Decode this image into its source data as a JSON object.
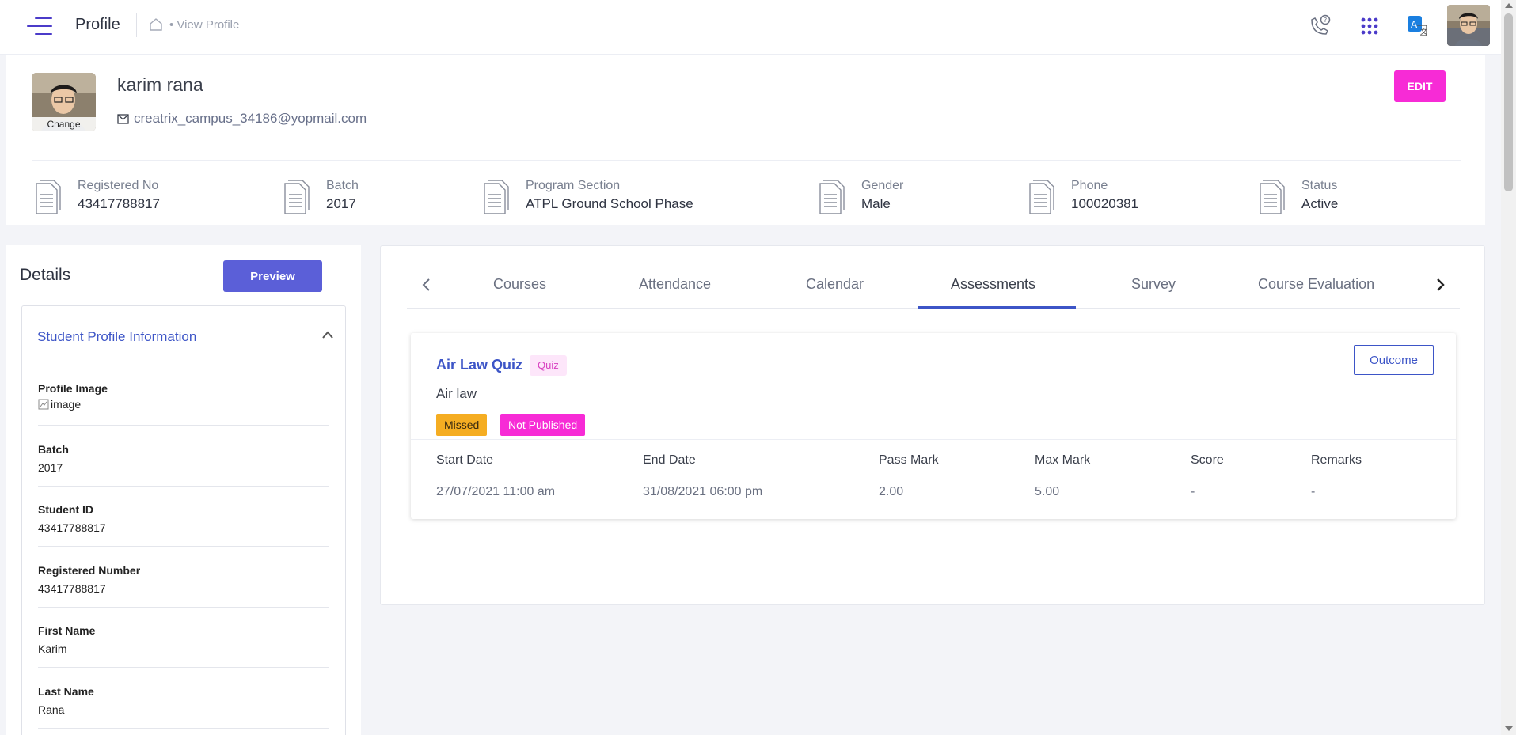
{
  "header": {
    "title": "Profile",
    "breadcrumb": "View Profile"
  },
  "icons": {
    "menu": "hamburger-menu-icon",
    "home": "home-icon",
    "support": "phone-help-icon",
    "apps": "apps-grid-icon",
    "translate": "translate-icon"
  },
  "colors": {
    "brand": "#4b3bc9",
    "accent_blue": "#3d55c7",
    "accent_pink": "#f72bd6",
    "missed": "#f5ad22"
  },
  "profile": {
    "change_label": "Change",
    "name": "karim rana",
    "email": "creatrix_campus_34186@yopmail.com",
    "edit_label": "EDIT",
    "info": [
      {
        "label": "Registered No",
        "value": "43417788817"
      },
      {
        "label": "Batch",
        "value": "2017"
      },
      {
        "label": "Program Section",
        "value": "ATPL Ground School Phase"
      },
      {
        "label": "Gender",
        "value": "Male"
      },
      {
        "label": "Phone",
        "value": "100020381"
      },
      {
        "label": "Status",
        "value": "Active"
      }
    ]
  },
  "details": {
    "title": "Details",
    "preview_label": "Preview",
    "section_title": "Student Profile Information",
    "fields": [
      {
        "label": "Profile Image",
        "value": "image"
      },
      {
        "label": "Batch",
        "value": "2017"
      },
      {
        "label": "Student ID",
        "value": "43417788817"
      },
      {
        "label": "Registered Number",
        "value": "43417788817"
      },
      {
        "label": "First Name",
        "value": "Karim"
      },
      {
        "label": "Last Name",
        "value": "Rana"
      }
    ]
  },
  "tabs": {
    "items": [
      "Courses",
      "Attendance",
      "Calendar",
      "Assessments",
      "Survey",
      "Course Evaluation"
    ],
    "active": "Assessments"
  },
  "assessment": {
    "title": "Air Law Quiz",
    "type": "Quiz",
    "subject": "Air law",
    "badges": [
      "Missed",
      "Not Published"
    ],
    "outcome_label": "Outcome",
    "columns": [
      "Start Date",
      "End Date",
      "Pass Mark",
      "Max Mark",
      "Score",
      "Remarks"
    ],
    "values": [
      "27/07/2021 11:00 am",
      "31/08/2021 06:00 pm",
      "2.00",
      "5.00",
      "-",
      "-"
    ]
  }
}
